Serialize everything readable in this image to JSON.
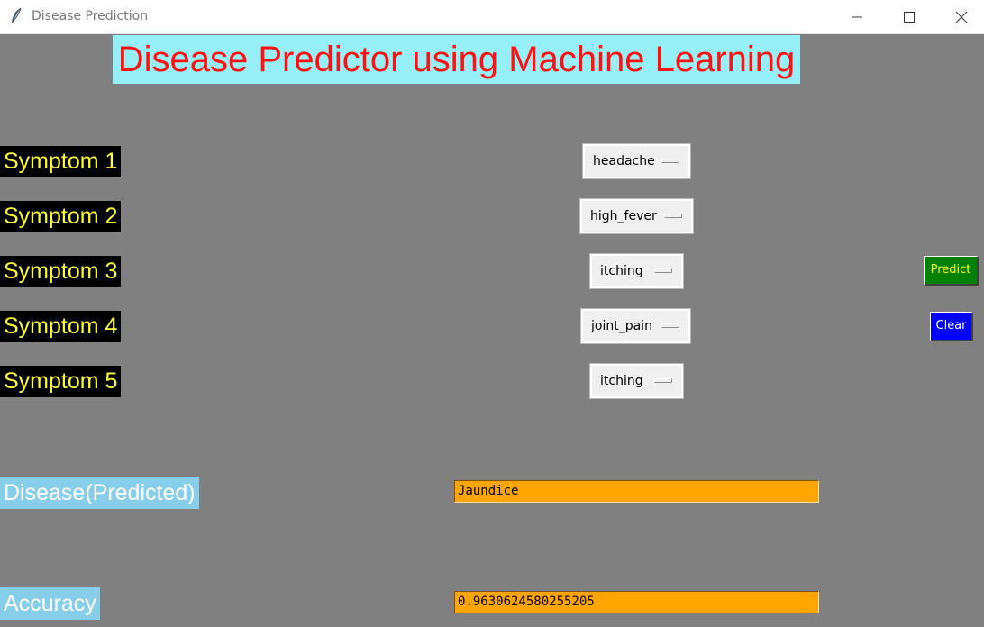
{
  "window": {
    "title": "Disease Prediction",
    "icon": "feather-icon"
  },
  "header": {
    "title": "Disease Predictor using Machine Learning"
  },
  "symptoms": [
    {
      "label": "Symptom 1",
      "value": "headache"
    },
    {
      "label": "Symptom 2",
      "value": "high_fever"
    },
    {
      "label": "Symptom 3",
      "value": "itching"
    },
    {
      "label": "Symptom 4",
      "value": "joint_pain"
    },
    {
      "label": "Symptom 5",
      "value": "itching"
    }
  ],
  "actions": {
    "predict_label": "Predict",
    "clear_label": "Clear"
  },
  "results": {
    "disease_label": "Disease(Predicted)",
    "disease_value": "Jaundice",
    "accuracy_label": "Accuracy",
    "accuracy_value": "0.9630624580255205"
  },
  "colors": {
    "background": "#808080",
    "title_bg": "#97f0f8",
    "title_text": "#ff1111",
    "symptom_label_bg": "#000000",
    "symptom_label_text": "#ffff33",
    "predict_bg": "#008000",
    "predict_text": "#ffff00",
    "clear_bg": "#0000ff",
    "clear_text": "#ffffff",
    "result_label_bg": "#87ceeb",
    "result_field_bg": "#ffa500"
  }
}
